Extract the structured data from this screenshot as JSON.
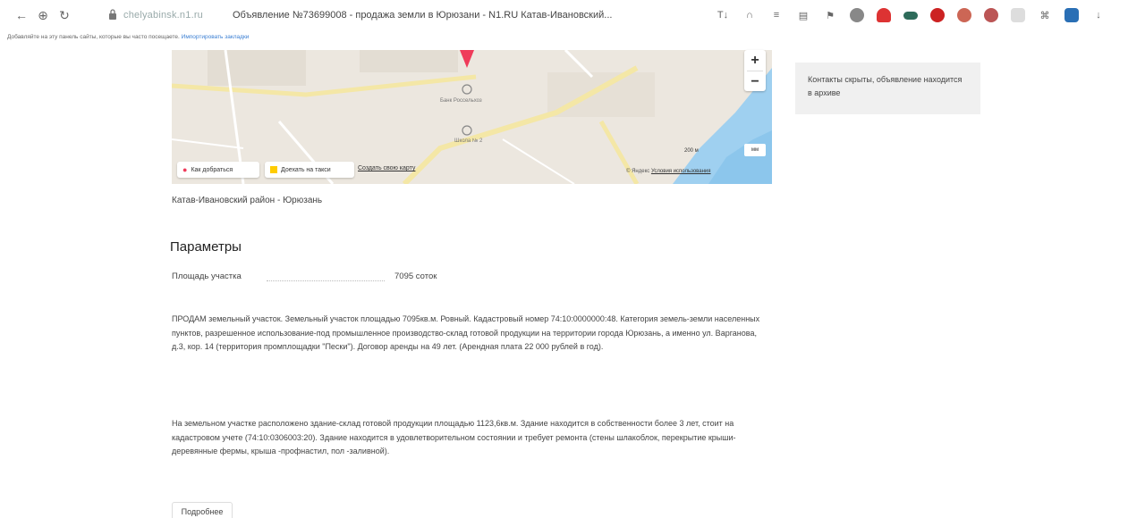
{
  "browser": {
    "nav": {
      "back": "←",
      "forward": "⊕",
      "reload": "↻"
    },
    "url_domain": "chelyabinsk.n1.ru",
    "tab_title": "Объявление №73699008 - продажа земли в Юрюзани - N1.RU Катав-Ивановский...",
    "bookmarks_hint": "Добавляйте на эту панель сайты, которые вы часто посещаете.",
    "bookmarks_link": "Импортировать закладки"
  },
  "map": {
    "zoom_in": "+",
    "zoom_out": "−",
    "route_label": "Как добраться",
    "taxi_label": "Доехать на такси",
    "create_map_label": "Создать свою карту",
    "scale_label": "200 м",
    "scale_units": "мм",
    "copyright": "© Яндекс",
    "terms": "Условия использования",
    "poi_1": "Банк Россельхоз",
    "poi_2": "Школа № 2"
  },
  "archive_note": "Контакты скрыты, объявление находится в архиве",
  "location": "Катав-Ивановский район  -  Юрюзань",
  "params": {
    "title": "Параметры",
    "area_label": "Площадь участка",
    "area_value": "7095 соток"
  },
  "description": {
    "p1": "ПРОДАМ земельный участок. Земельный участок площадью 7095кв.м. Ровный. Кадастровый номер 74:10:0000000:48. Категория земель-земли населенных пунктов, разрешенное использование-под промышленное производство-склад готовой продукции на территории города Юрюзань, а именно ул. Варганова, д.3, кор. 14 (территория промплощадки \"Пески\"). Договор аренды на 49 лет. (Арендная плата 22 000 рублей в год).",
    "p2": "На земельном участке расположено здание-склад готовой продукции площадью 1123,6кв.м. Здание находится в собственности более 3 лет, стоит на кадастровом учете (74:10:0306003:20). Здание находится в удовлетворительном состоянии и требует ремонта (стены шлакоблок, перекрытие крыши-деревянные фермы, крыша -профнастил, пол -заливной)."
  },
  "more_button": "Подробнее",
  "colors": {
    "pin": "#ef3b5a",
    "water": "#9fd0f0",
    "road": "#f5e9a8",
    "link": "#3b7fd3"
  }
}
